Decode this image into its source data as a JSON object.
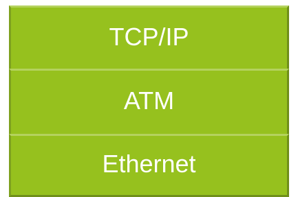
{
  "layers": [
    {
      "label": "TCP/IP"
    },
    {
      "label": "ATM"
    },
    {
      "label": "Ethernet"
    }
  ],
  "colors": {
    "fill": "#96c11e",
    "text": "#ffffff",
    "border": "#7ea11f"
  }
}
